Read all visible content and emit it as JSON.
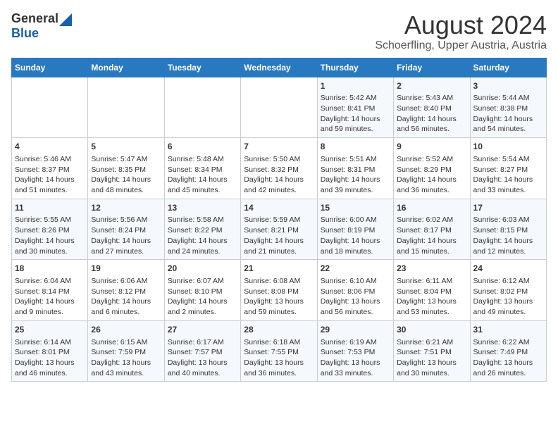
{
  "header": {
    "logo_general": "General",
    "logo_blue": "Blue",
    "title": "August 2024",
    "subtitle": "Schoerfling, Upper Austria, Austria"
  },
  "days_of_week": [
    "Sunday",
    "Monday",
    "Tuesday",
    "Wednesday",
    "Thursday",
    "Friday",
    "Saturday"
  ],
  "weeks": [
    [
      {
        "day": "",
        "info": ""
      },
      {
        "day": "",
        "info": ""
      },
      {
        "day": "",
        "info": ""
      },
      {
        "day": "",
        "info": ""
      },
      {
        "day": "1",
        "info": "Sunrise: 5:42 AM\nSunset: 8:41 PM\nDaylight: 14 hours\nand 59 minutes."
      },
      {
        "day": "2",
        "info": "Sunrise: 5:43 AM\nSunset: 8:40 PM\nDaylight: 14 hours\nand 56 minutes."
      },
      {
        "day": "3",
        "info": "Sunrise: 5:44 AM\nSunset: 8:38 PM\nDaylight: 14 hours\nand 54 minutes."
      }
    ],
    [
      {
        "day": "4",
        "info": "Sunrise: 5:46 AM\nSunset: 8:37 PM\nDaylight: 14 hours\nand 51 minutes."
      },
      {
        "day": "5",
        "info": "Sunrise: 5:47 AM\nSunset: 8:35 PM\nDaylight: 14 hours\nand 48 minutes."
      },
      {
        "day": "6",
        "info": "Sunrise: 5:48 AM\nSunset: 8:34 PM\nDaylight: 14 hours\nand 45 minutes."
      },
      {
        "day": "7",
        "info": "Sunrise: 5:50 AM\nSunset: 8:32 PM\nDaylight: 14 hours\nand 42 minutes."
      },
      {
        "day": "8",
        "info": "Sunrise: 5:51 AM\nSunset: 8:31 PM\nDaylight: 14 hours\nand 39 minutes."
      },
      {
        "day": "9",
        "info": "Sunrise: 5:52 AM\nSunset: 8:29 PM\nDaylight: 14 hours\nand 36 minutes."
      },
      {
        "day": "10",
        "info": "Sunrise: 5:54 AM\nSunset: 8:27 PM\nDaylight: 14 hours\nand 33 minutes."
      }
    ],
    [
      {
        "day": "11",
        "info": "Sunrise: 5:55 AM\nSunset: 8:26 PM\nDaylight: 14 hours\nand 30 minutes."
      },
      {
        "day": "12",
        "info": "Sunrise: 5:56 AM\nSunset: 8:24 PM\nDaylight: 14 hours\nand 27 minutes."
      },
      {
        "day": "13",
        "info": "Sunrise: 5:58 AM\nSunset: 8:22 PM\nDaylight: 14 hours\nand 24 minutes."
      },
      {
        "day": "14",
        "info": "Sunrise: 5:59 AM\nSunset: 8:21 PM\nDaylight: 14 hours\nand 21 minutes."
      },
      {
        "day": "15",
        "info": "Sunrise: 6:00 AM\nSunset: 8:19 PM\nDaylight: 14 hours\nand 18 minutes."
      },
      {
        "day": "16",
        "info": "Sunrise: 6:02 AM\nSunset: 8:17 PM\nDaylight: 14 hours\nand 15 minutes."
      },
      {
        "day": "17",
        "info": "Sunrise: 6:03 AM\nSunset: 8:15 PM\nDaylight: 14 hours\nand 12 minutes."
      }
    ],
    [
      {
        "day": "18",
        "info": "Sunrise: 6:04 AM\nSunset: 8:14 PM\nDaylight: 14 hours\nand 9 minutes."
      },
      {
        "day": "19",
        "info": "Sunrise: 6:06 AM\nSunset: 8:12 PM\nDaylight: 14 hours\nand 6 minutes."
      },
      {
        "day": "20",
        "info": "Sunrise: 6:07 AM\nSunset: 8:10 PM\nDaylight: 14 hours\nand 2 minutes."
      },
      {
        "day": "21",
        "info": "Sunrise: 6:08 AM\nSunset: 8:08 PM\nDaylight: 13 hours\nand 59 minutes."
      },
      {
        "day": "22",
        "info": "Sunrise: 6:10 AM\nSunset: 8:06 PM\nDaylight: 13 hours\nand 56 minutes."
      },
      {
        "day": "23",
        "info": "Sunrise: 6:11 AM\nSunset: 8:04 PM\nDaylight: 13 hours\nand 53 minutes."
      },
      {
        "day": "24",
        "info": "Sunrise: 6:12 AM\nSunset: 8:02 PM\nDaylight: 13 hours\nand 49 minutes."
      }
    ],
    [
      {
        "day": "25",
        "info": "Sunrise: 6:14 AM\nSunset: 8:01 PM\nDaylight: 13 hours\nand 46 minutes."
      },
      {
        "day": "26",
        "info": "Sunrise: 6:15 AM\nSunset: 7:59 PM\nDaylight: 13 hours\nand 43 minutes."
      },
      {
        "day": "27",
        "info": "Sunrise: 6:17 AM\nSunset: 7:57 PM\nDaylight: 13 hours\nand 40 minutes."
      },
      {
        "day": "28",
        "info": "Sunrise: 6:18 AM\nSunset: 7:55 PM\nDaylight: 13 hours\nand 36 minutes."
      },
      {
        "day": "29",
        "info": "Sunrise: 6:19 AM\nSunset: 7:53 PM\nDaylight: 13 hours\nand 33 minutes."
      },
      {
        "day": "30",
        "info": "Sunrise: 6:21 AM\nSunset: 7:51 PM\nDaylight: 13 hours\nand 30 minutes."
      },
      {
        "day": "31",
        "info": "Sunrise: 6:22 AM\nSunset: 7:49 PM\nDaylight: 13 hours\nand 26 minutes."
      }
    ]
  ]
}
